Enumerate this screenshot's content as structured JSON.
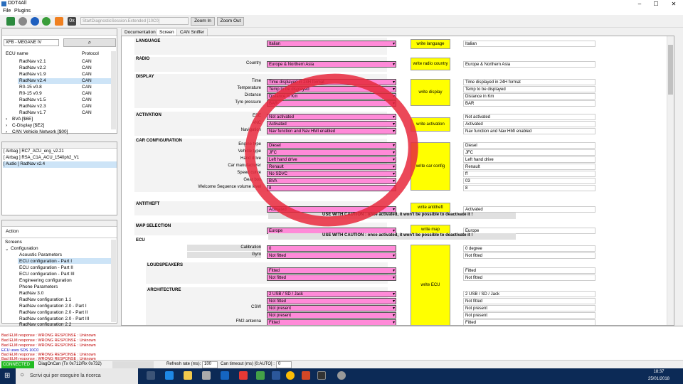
{
  "window": {
    "title": "DDT4All"
  },
  "menu": [
    "File",
    "Plugins"
  ],
  "toolbar": {
    "session": "StartDiagnosticSession.Extended [10C0]",
    "zoom_in": "Zoom In",
    "zoom_out": "Zoom Out"
  },
  "vehicle_select": "XFB - MEGANE IV",
  "ecu_table": {
    "headers": [
      "ECU name",
      "Protocol"
    ],
    "rows": [
      {
        "name": "RadNav v2.1",
        "protocol": "CAN"
      },
      {
        "name": "RadNav v2.2",
        "protocol": "CAN"
      },
      {
        "name": "RadNav v1.9",
        "protocol": "CAN"
      },
      {
        "name": "RadNav v2.4",
        "protocol": "CAN"
      },
      {
        "name": "R0-15 v0.8",
        "protocol": "CAN"
      },
      {
        "name": "R0-15 v0.9",
        "protocol": "CAN"
      },
      {
        "name": "RadNav v1.5",
        "protocol": "CAN"
      },
      {
        "name": "RadNav v2.3",
        "protocol": "CAN"
      },
      {
        "name": "RadNav v1.7",
        "protocol": "CAN"
      }
    ],
    "groups": [
      "BVA [$6E]",
      "C-Display [$E2]",
      "CAN Vehicle Network [$00]"
    ]
  },
  "ecu_files": [
    "[ Airbag ] RC7_ACU_eng_v2.21",
    "[ Airbag ] RSA_C1A_ACU_1540ph2_V1",
    "[ Audio ] RadNav v2.4"
  ],
  "action_label": "Action",
  "screens": {
    "root": "Screens",
    "group": "Configuration",
    "items": [
      "Acoustic Parameters",
      "ECU configuration - Part I",
      "ECU configuration - Part II",
      "ECU configuration - Part III",
      "Engineering configuration",
      "Phone Parameters",
      "RadNav 3.0",
      "RadNav configuration 1.1",
      "RadNav configuration 2.0 - Part I",
      "RadNav configuration 2.0 - Part II",
      "RadNav configuration 2.0 - Part III",
      "RadNav configuration 2.2"
    ]
  },
  "tabs": [
    "Documentation",
    "Screen",
    "CAN Sniffer"
  ],
  "sections": {
    "language": {
      "title": "LANGUAGE",
      "value": "Italian",
      "button": "write language",
      "current": "Italian"
    },
    "radio": {
      "title": "RADIO",
      "label": "Country",
      "value": "Europe & Northern Asia",
      "button": "write radio country",
      "current": "Europe & Northern Asia"
    },
    "display": {
      "title": "DISPLAY",
      "button": "write display",
      "fields": [
        {
          "label": "Time",
          "value": "Time displayed in 24H format",
          "current": "Time displayed in 24H format"
        },
        {
          "label": "Temperature",
          "value": "Temp to be displayed",
          "current": "Temp to be displayed"
        },
        {
          "label": "Distance",
          "value": "Distance in Km",
          "current": "Distance in Km"
        },
        {
          "label": "Tyre pressure",
          "value": "BAR",
          "current": "BAR"
        }
      ]
    },
    "activation": {
      "title": "ACTIVATION",
      "button": "write activation",
      "fields": [
        {
          "label": "ESE",
          "value": "Not activated",
          "current": "Not activated"
        },
        {
          "label": "ANC",
          "value": "Activated",
          "current": "Activated"
        },
        {
          "label": "Navigation",
          "value": "Nav function and Nav HMI enabled",
          "current": "Nav function and Nav HMI enabled"
        }
      ]
    },
    "car_config": {
      "title": "CAR CONFIGURATION",
      "button": "write car config",
      "fields": [
        {
          "label": "Engine type",
          "value": "Diesel",
          "current": "Diesel"
        },
        {
          "label": "Vehicle type",
          "value": "JFC",
          "current": "JFC"
        },
        {
          "label": "Hand drive",
          "value": "Left hand drive",
          "current": "Left hand drive"
        },
        {
          "label": "Car manufacturer",
          "value": "Renault",
          "current": "Renault"
        },
        {
          "label": "Speed curve",
          "value": "No SDVC",
          "current": "ff"
        },
        {
          "label": "Gear box",
          "value": "BVA",
          "current": "03"
        },
        {
          "label": "Welcome Sequence volume level",
          "value": "8",
          "current": "8"
        }
      ]
    },
    "antitheft": {
      "title": "ANTITHEFT",
      "value": "Activated",
      "button": "write antitheft",
      "current": "Activated",
      "caution": "USE WITH CAUTION : once activated, it won't be possible to deactivate it !"
    },
    "map": {
      "title": "MAP SELECTION",
      "value": "Europe",
      "button": "write map",
      "current": "Europe",
      "caution": "USE WITH CAUTION : once activated, it won't be possible to deactivate it !"
    },
    "ecu": {
      "title": "ECU",
      "button": "write ECU",
      "fields": [
        {
          "label": "Calibration",
          "value": "0",
          "current": "0 degree"
        },
        {
          "label": "Gyro",
          "value": "Not fitted",
          "current": "Not fitted"
        }
      ],
      "loudspeakers": {
        "title": "LOUDSPEAKERS",
        "fields": [
          {
            "value": "Fitted",
            "current": "Fitted"
          },
          {
            "value": "Not fitted",
            "current": "Not fitted"
          }
        ]
      },
      "architecture": {
        "title": "ARCHITECTURE",
        "fields": [
          {
            "label": "",
            "value": "2 USB / SD / Jack",
            "current": "2 USB / SD / Jack"
          },
          {
            "label": "",
            "value": "Not fitted",
            "current": "Not fitted"
          },
          {
            "label": "CSW",
            "value": "Not present",
            "current": "Not present"
          },
          {
            "label": "",
            "value": "Not present",
            "current": "Not present"
          },
          {
            "label": "FM2 antenna",
            "value": "Fitted",
            "current": "Fitted"
          }
        ]
      }
    }
  },
  "log": [
    {
      "text": "Bad ELM response : WRONG RESPONSE : Unknown",
      "color": "#c00000"
    },
    {
      "text": "Bad ELM response : WRONG RESPONSE : Unknown",
      "color": "#c00000"
    },
    {
      "text": "Bad ELM response : WRONG RESPONSE : Unknown",
      "color": "#c00000"
    },
    {
      "text": "ECU uses SDS 10C0",
      "color": "#0000c0"
    },
    {
      "text": "Bad ELM response : WRONG RESPONSE : Unknown",
      "color": "#c00000"
    },
    {
      "text": "Bad ELM response : WRONG RESPONSE : Unknown",
      "color": "#c00000"
    }
  ],
  "status": {
    "connected": "CONNECTED",
    "protocol": "DiagOnCan (Tx 0x712/Rx 0x732)",
    "refresh_label": "Refresh rate (ms):",
    "refresh_value": "100",
    "timeout_label": "Can timeout (ms) [0:AUTO] :",
    "timeout_value": "0"
  },
  "taskbar": {
    "search": "Scrivi qui per eseguire la ricerca",
    "time": "18:37",
    "date": "25/01/2018"
  },
  "colors": {
    "dropdown": "#ff8ad8",
    "write_button": "#ffff00",
    "annotation_circle": "#e8283c",
    "connected": "#22bb22"
  }
}
